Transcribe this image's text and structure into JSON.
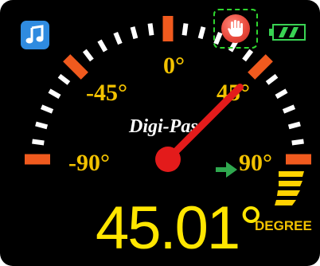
{
  "gauge": {
    "brand": "Digi-Pas",
    "labels": {
      "zero": "0°",
      "neg45": "-45°",
      "pos45": "45°",
      "neg90": "-90°",
      "pos90": "90°"
    },
    "needle_angle_deg": 45.01
  },
  "reading": {
    "value": "45.01°",
    "unit": "DEGREE"
  },
  "toolbar": {
    "music_icon": "music-note-icon",
    "stop_icon": "stop-hand-icon"
  },
  "status": {
    "battery_icon": "battery-icon",
    "battery_bars": 2
  },
  "colors": {
    "accent_yellow": "#ffe600",
    "label_yellow": "#f2c200",
    "tick_orange": "#f05a1e",
    "needle_red": "#e31b1b",
    "indicator_green": "#2fa84f",
    "battery_green": "#39d353",
    "music_blue": "#2f8be0"
  }
}
